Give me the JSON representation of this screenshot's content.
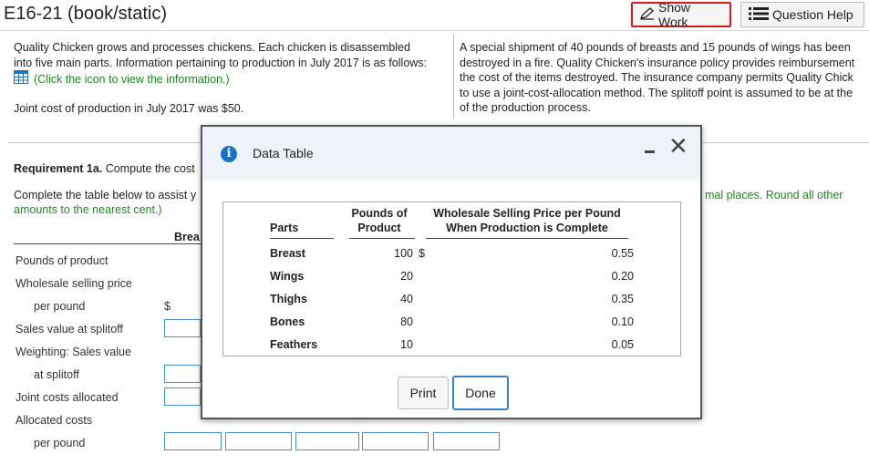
{
  "header": {
    "title": "E16-21 (book/static)",
    "show_work": "Show Work",
    "question_help": "Question Help"
  },
  "left_text": {
    "line1": "Quality Chicken grows and processes chickens. Each chicken is disassembled",
    "line2": "into five main parts. Information pertaining to production in July 2017 is as follows:",
    "link": "(Click the icon to view the information.)",
    "joint_cost": "Joint cost of production in July 2017 was $50."
  },
  "right_text": {
    "line1": "A special shipment of 40 pounds of breasts and 15 pounds of wings has been",
    "line2": "destroyed in a fire. Quality Chicken's insurance policy provides reimbursement",
    "line3": "the cost of the items destroyed. The insurance company permits Quality Chick",
    "line4": "to use a joint-cost-allocation method. The splitoff point is assumed to be at the",
    "line5": "of the production process."
  },
  "requirement": {
    "label_bold": "Requirement 1a.",
    "label_rest": "Compute the cost",
    "instr1": "Complete the table below to assist y",
    "instr_right": "mal places. Round all other",
    "instr2": "amounts to the nearest cent.)",
    "col_head": "Brea"
  },
  "rows": {
    "pounds": "Pounds of product",
    "wholesale": "Wholesale selling price",
    "per_pound": "per pound",
    "dollar": "$",
    "sales_value": "Sales value at splitoff",
    "weighting": "Weighting: Sales value",
    "at_splitoff": "at splitoff",
    "joint_alloc": "Joint costs allocated",
    "allocated": "Allocated costs",
    "per_pound2": "per pound"
  },
  "modal": {
    "title": "Data Table",
    "col_parts": "Parts",
    "col_pounds_1": "Pounds of",
    "col_pounds_2": "Product",
    "col_price_1": "Wholesale Selling Price per Pound",
    "col_price_2": "When Production is Complete",
    "dollar": "$",
    "data": [
      {
        "part": "Breast",
        "pounds": "100",
        "price": "0.55"
      },
      {
        "part": "Wings",
        "pounds": "20",
        "price": "0.20"
      },
      {
        "part": "Thighs",
        "pounds": "40",
        "price": "0.35"
      },
      {
        "part": "Bones",
        "pounds": "80",
        "price": "0.10"
      },
      {
        "part": "Feathers",
        "pounds": "10",
        "price": "0.05"
      }
    ],
    "print": "Print",
    "done": "Done"
  }
}
